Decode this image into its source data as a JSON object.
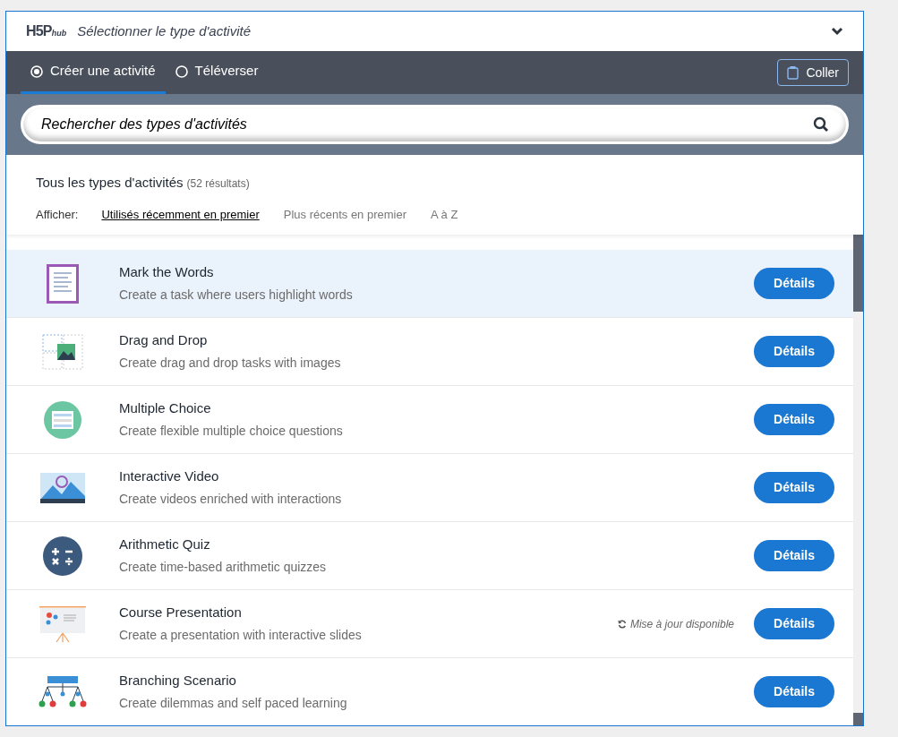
{
  "header": {
    "logo": "H5P",
    "logo_suffix": "hub",
    "title": "Sélectionner le type d'activité",
    "expanded": false
  },
  "tabs": [
    {
      "label": "Créer une activité",
      "selected": true
    },
    {
      "label": "Téléverser",
      "selected": false
    }
  ],
  "paste_button": "Coller",
  "search": {
    "placeholder": "Rechercher des types d'activités"
  },
  "results": {
    "heading": "Tous les types d'activités",
    "count": "(52 résultats)"
  },
  "sort": {
    "label": "Afficher:",
    "options": [
      {
        "label": "Utilisés récemment en premier",
        "selected": true
      },
      {
        "label": "Plus récents en premier",
        "selected": false
      },
      {
        "label": "A à Z",
        "selected": false
      }
    ]
  },
  "activities": [
    {
      "kind": "mark",
      "title": "Mark the Words",
      "description": "Create a task where users highlight words",
      "highlighted": true,
      "button": "Détails"
    },
    {
      "kind": "dragdrop",
      "title": "Drag and Drop",
      "description": "Create drag and drop tasks with images",
      "highlighted": false,
      "button": "Détails"
    },
    {
      "kind": "choice",
      "title": "Multiple Choice",
      "description": "Create flexible multiple choice questions",
      "highlighted": false,
      "button": "Détails"
    },
    {
      "kind": "video",
      "title": "Interactive Video",
      "description": "Create videos enriched with interactions",
      "highlighted": false,
      "button": "Détails"
    },
    {
      "kind": "arithmetic",
      "title": "Arithmetic Quiz",
      "description": "Create time-based arithmetic quizzes",
      "highlighted": false,
      "button": "Détails"
    },
    {
      "kind": "presentation",
      "title": "Course Presentation",
      "description": "Create a presentation with interactive slides",
      "update": "Mise à jour disponible",
      "highlighted": false,
      "button": "Détails"
    },
    {
      "kind": "branching",
      "title": "Branching Scenario",
      "description": "Create dilemmas and self paced learning",
      "highlighted": false,
      "button": "Détails"
    }
  ]
}
